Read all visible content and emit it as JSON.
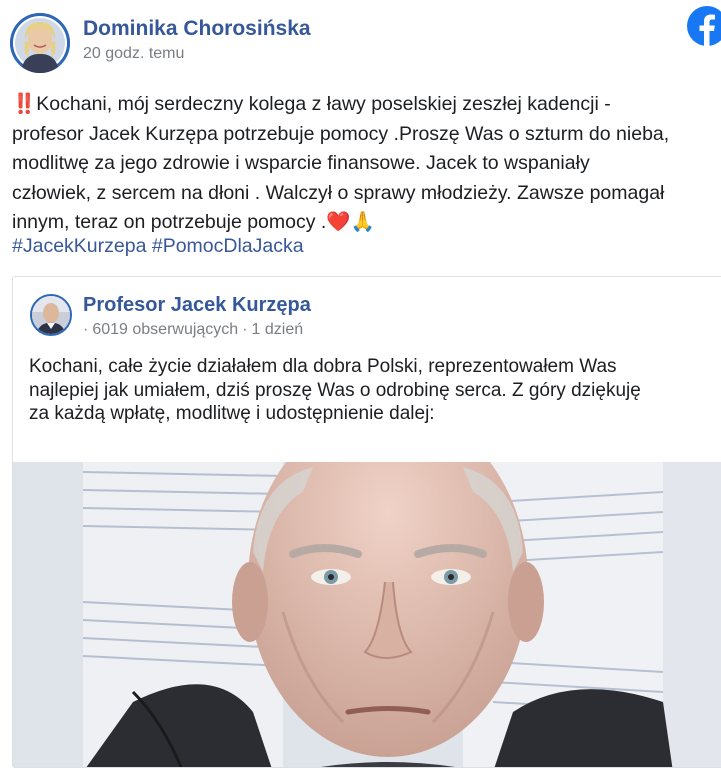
{
  "post": {
    "author": "Dominika Chorosińska",
    "time": "20 godz. temu",
    "emoji_start": "‼️",
    "lines": [
      "Kochani, mój serdeczny kolega z ławy poselskiej zeszłej kadencji -",
      "profesor Jacek Kurzępa potrzebuje pomocy .Proszę Was o szturm do nieba,",
      "modlitwę za jego zdrowie i wsparcie finansowe. Jacek to wspaniały",
      "człowiek, z sercem na dłoni . Walczył o sprawy młodzieży. Zawsze pomagał",
      "innym, teraz on potrzebuje pomocy ."
    ],
    "emoji_end": "❤️🙏",
    "hashtags": [
      "#JacekKurzepa",
      "#PomocDlaJacka"
    ]
  },
  "shared": {
    "author": "Profesor Jacek Kurzępa",
    "followers": "6019 obserwujących",
    "time": "1 dzień",
    "lines": [
      "Kochani, całe życie działałem dla dobra Polski, reprezentowałem Was",
      "najlepiej jak umiałem, dziś proszę Was o odrobinę serca. Z góry dziękuję",
      "za każdą wpłatę, modlitwę i udostępnienie dalej:"
    ]
  },
  "colors": {
    "link_blue": "#365899",
    "facebook_blue": "#1877f2",
    "meta_gray": "#7a7d82",
    "text": "#1c1e21"
  },
  "icons": [
    "facebook-logo-icon"
  ]
}
